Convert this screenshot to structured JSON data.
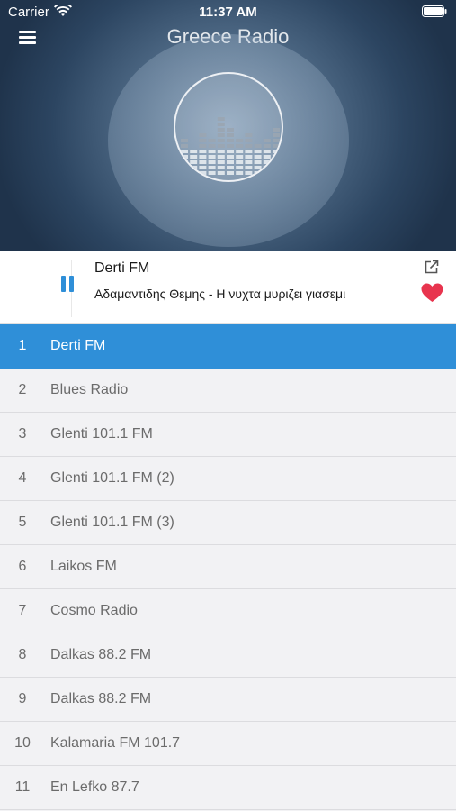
{
  "status_bar": {
    "carrier": "Carrier",
    "time": "11:37 AM"
  },
  "header": {
    "title": "Greece Radio"
  },
  "now_playing": {
    "station": "Derti FM",
    "track": "Αδαμαντιδης Θεμης - Η νυχτα μυριζει γιασεμι",
    "accent_color": "#2f8fd8",
    "heart_color": "#e8344e"
  },
  "stations": [
    {
      "num": "1",
      "name": "Derti FM"
    },
    {
      "num": "2",
      "name": "Blues Radio"
    },
    {
      "num": "3",
      "name": "Glenti 101.1 FM"
    },
    {
      "num": "4",
      "name": "Glenti 101.1 FM (2)"
    },
    {
      "num": "5",
      "name": "Glenti 101.1 FM (3)"
    },
    {
      "num": "6",
      "name": "Laikos FM"
    },
    {
      "num": "7",
      "name": "Cosmo Radio"
    },
    {
      "num": "8",
      "name": "Dalkas 88.2 FM"
    },
    {
      "num": "9",
      "name": "Dalkas 88.2 FM"
    },
    {
      "num": "10",
      "name": "Kalamaria FM 101.7"
    },
    {
      "num": "11",
      "name": "En Lefko 87.7"
    }
  ]
}
